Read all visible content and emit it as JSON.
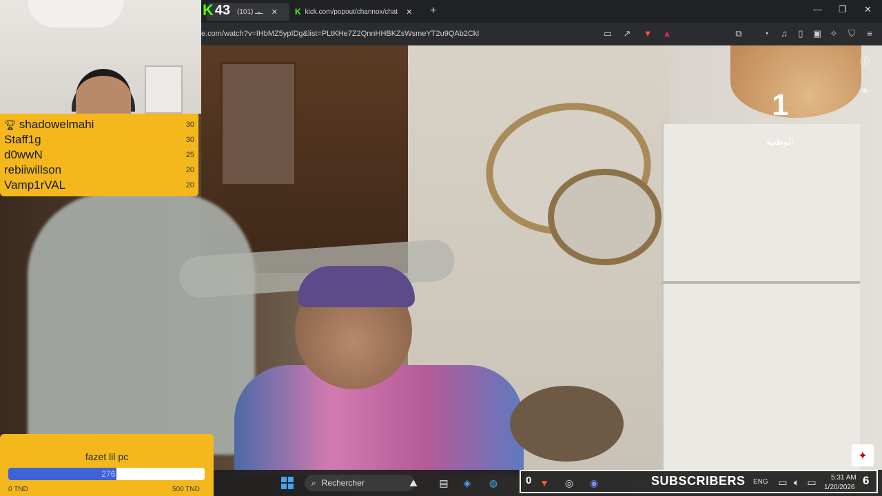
{
  "browser": {
    "tabs": [
      {
        "label": "(101) ـمـ",
        "icon": "kick-icon"
      },
      {
        "label": "kick.com/popout/channox/chat",
        "icon": "kick-icon"
      }
    ],
    "tab_count_badge": "43",
    "url": "e.com/watch?v=IHbMZ5ypIDg&list=PLtKHe7Z2QnnHHBKZsWsmeYT2u9QAb2CkI"
  },
  "leaderboard": [
    {
      "name": "shadowelmahi",
      "score": "30",
      "icon": "trophy-icon"
    },
    {
      "name": "Staff1g",
      "score": "30"
    },
    {
      "name": "d0wwN",
      "score": "25"
    },
    {
      "name": "rebiiwillson",
      "score": "20"
    },
    {
      "name": "Vamp1rVAL",
      "score": "20"
    }
  ],
  "goal": {
    "title": "fazet lil pc",
    "current": "276",
    "min_label": "0 TND",
    "max_label": "500 TND",
    "progress_fraction": 0.552,
    "fill_color": "#3e63d8"
  },
  "channel_logo": {
    "number": "1",
    "text": "الوطنية"
  },
  "taskbar": {
    "search_label": "Rechercher",
    "subs_count_left": "0",
    "subs_label": "SUBSCRIBERS",
    "subs_count_right": "6",
    "language": "ENG",
    "time": "5:31 AM",
    "date": "1/20/2026"
  },
  "colors": {
    "overlay_yellow": "#f4b81c",
    "kick_green": "#53fc18",
    "brave_orange": "#fb542b"
  }
}
